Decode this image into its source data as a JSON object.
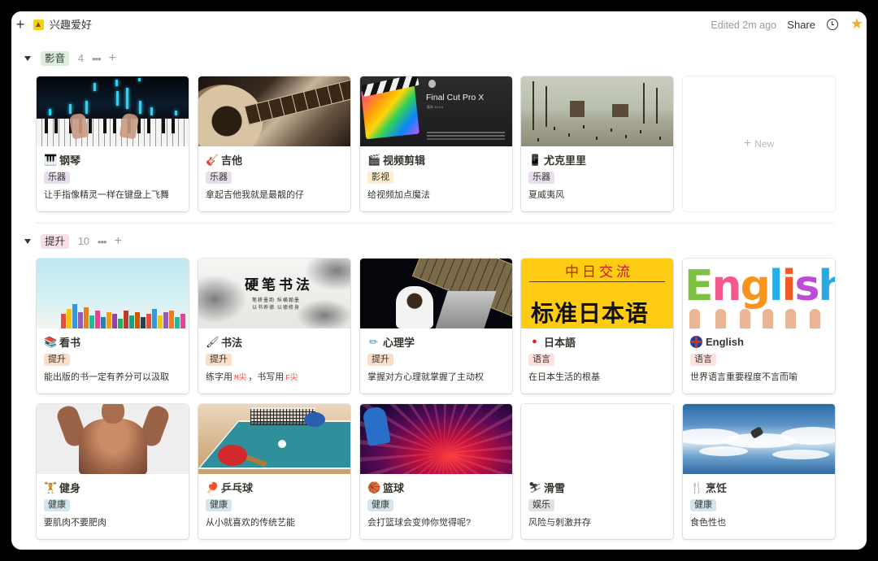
{
  "topbar": {
    "add_glyph": "+",
    "title": "兴趣爱好",
    "page_icon": "yellow-warning-icon",
    "edited": "Edited 2m ago",
    "share": "Share",
    "updates_icon": "clock-icon",
    "favorite_icon": "star-icon",
    "favorite_glyph": "★"
  },
  "groups": [
    {
      "label": "影音",
      "count": "4",
      "tag_color": "#dbeddb",
      "more_glyph": "•••",
      "add_glyph": "+",
      "cards": [
        {
          "title": "钢琴",
          "icon": "🎹",
          "tag": "乐器",
          "tag_color": "#e8deee",
          "desc": "让手指像精灵一样在键盘上飞舞"
        },
        {
          "title": "吉他",
          "icon": "🎸",
          "tag": "乐器",
          "tag_color": "#e8deee",
          "desc": "拿起吉他我就是最靓的仔"
        },
        {
          "title": "视频剪辑",
          "icon": "🎬",
          "tag": "影视",
          "tag_color": "#fdecc8",
          "desc": "给视频加点魔法"
        },
        {
          "title": "尤克里里",
          "icon": "📱",
          "tag": "乐器",
          "tag_color": "#e8deee",
          "desc": "夏威夷风"
        }
      ],
      "new_label": "New",
      "new_glyph": "+"
    },
    {
      "label": "提升",
      "count": "10",
      "tag_color": "#f5e0e9",
      "more_glyph": "•••",
      "add_glyph": "+",
      "cards": [
        {
          "title": "看书",
          "icon": "📚",
          "tag": "提升",
          "tag_color": "#fadec9",
          "desc": "能出版的书一定有养分可以汲取"
        },
        {
          "title": "书法",
          "icon": "🖌",
          "tag": "提升",
          "tag_color": "#fadec9",
          "desc_parts": [
            "练字用",
            "M尖",
            "，书写用",
            "F尖"
          ]
        },
        {
          "title": "心理学",
          "icon": "✏",
          "tag": "提升",
          "tag_color": "#fadec9",
          "desc": "掌握对方心理就掌握了主动权"
        },
        {
          "title": "日本語",
          "icon": "●",
          "tag": "语言",
          "tag_color": "#ffe2dd",
          "desc": "在日本生活的根基"
        },
        {
          "title": "English",
          "icon": "🇬🇧",
          "tag": "语言",
          "tag_color": "#ffe2dd",
          "desc": "世界语言重要程度不言而喻"
        },
        {
          "title": "健身",
          "icon": "🏋",
          "tag": "健康",
          "tag_color": "#d3e5ef",
          "desc": "要肌肉不要肥肉"
        },
        {
          "title": "乒乓球",
          "icon": "🏓",
          "tag": "健康",
          "tag_color": "#d3e5ef",
          "desc": "从小就喜欢的传统艺能"
        },
        {
          "title": "篮球",
          "icon": "🏀",
          "tag": "健康",
          "tag_color": "#d3e5ef",
          "desc": "会打篮球会变帅你觉得呢?"
        },
        {
          "title": "滑雪",
          "icon": "⛷",
          "tag": "娱乐",
          "tag_color": "#e3e2e0",
          "desc": "风险与刺激并存"
        },
        {
          "title": "烹饪",
          "icon": "🍴",
          "tag": "健康",
          "tag_color": "#d3e5ef",
          "desc": "食色性也"
        }
      ]
    }
  ],
  "covers": {
    "fcp_title": "Final Cut Pro X",
    "fcp_version": "版本 10.4.9",
    "calli_title": "硬笔书法",
    "calli_sub1": "笔耕墨韵 纵横翰墨",
    "calli_sub2": "以书养德 以德修身",
    "jp_top": "中日交流",
    "jp_main": "标准日本语",
    "eng_word": "English"
  }
}
